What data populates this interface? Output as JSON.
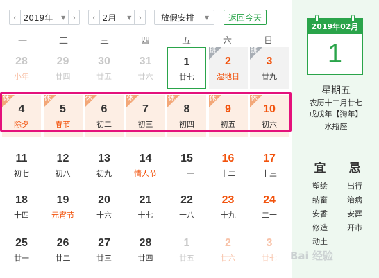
{
  "toolbar": {
    "year": "2019年",
    "month": "2月",
    "holiday": "放假安排",
    "today": "返回今天",
    "prev": "‹",
    "next": "›"
  },
  "weekdays": [
    "一",
    "二",
    "三",
    "四",
    "五",
    "六",
    "日"
  ],
  "rows": [
    [
      {
        "d": "28",
        "l": "小年",
        "other": true,
        "fest": true
      },
      {
        "d": "29",
        "l": "廿四",
        "other": true
      },
      {
        "d": "30",
        "l": "廿五",
        "other": true
      },
      {
        "d": "31",
        "l": "廿六",
        "other": true
      },
      {
        "d": "1",
        "l": "廿七",
        "today": true
      },
      {
        "d": "2",
        "l": "湿地日",
        "weekend": true,
        "fest": true,
        "tag": "班",
        "tagType": "work"
      },
      {
        "d": "3",
        "l": "廿九",
        "weekend": true,
        "tag": "班",
        "tagType": "work"
      }
    ],
    [
      {
        "d": "4",
        "l": "除夕",
        "fest": true,
        "tag": "休",
        "tagType": "rest"
      },
      {
        "d": "5",
        "l": "春节",
        "fest": true,
        "tag": "休",
        "tagType": "rest"
      },
      {
        "d": "6",
        "l": "初二",
        "tag": "休",
        "tagType": "rest"
      },
      {
        "d": "7",
        "l": "初三",
        "tag": "休",
        "tagType": "rest"
      },
      {
        "d": "8",
        "l": "初四",
        "tag": "休",
        "tagType": "rest"
      },
      {
        "d": "9",
        "l": "初五",
        "weekend": true,
        "tag": "休",
        "tagType": "rest"
      },
      {
        "d": "10",
        "l": "初六",
        "weekend": true,
        "tag": "休",
        "tagType": "rest"
      }
    ],
    [
      {
        "d": "11",
        "l": "初七"
      },
      {
        "d": "12",
        "l": "初八"
      },
      {
        "d": "13",
        "l": "初九"
      },
      {
        "d": "14",
        "l": "情人节",
        "fest": true
      },
      {
        "d": "15",
        "l": "十一"
      },
      {
        "d": "16",
        "l": "十二",
        "weekend": true
      },
      {
        "d": "17",
        "l": "十三",
        "weekend": true
      }
    ],
    [
      {
        "d": "18",
        "l": "十四"
      },
      {
        "d": "19",
        "l": "元宵节",
        "fest": true
      },
      {
        "d": "20",
        "l": "十六"
      },
      {
        "d": "21",
        "l": "十七"
      },
      {
        "d": "22",
        "l": "十八"
      },
      {
        "d": "23",
        "l": "十九",
        "weekend": true
      },
      {
        "d": "24",
        "l": "二十",
        "weekend": true
      }
    ],
    [
      {
        "d": "25",
        "l": "廿一"
      },
      {
        "d": "26",
        "l": "廿二"
      },
      {
        "d": "27",
        "l": "廿三"
      },
      {
        "d": "28",
        "l": "廿四"
      },
      {
        "d": "1",
        "l": "廿五",
        "other": true
      },
      {
        "d": "2",
        "l": "廿六",
        "other": true,
        "weekend": true
      },
      {
        "d": "3",
        "l": "廿七",
        "other": true,
        "weekend": true
      }
    ]
  ],
  "side": {
    "card_header": "2019年02月",
    "day": "1",
    "weekday": "星期五",
    "lunar": "农历十二月廿七",
    "ganzhi": "戊戌年【狗年】",
    "zodiac": "水瓶座",
    "yi_title": "宜",
    "ji_title": "忌",
    "yi": [
      "塑绘",
      "纳畜",
      "安香",
      "修造",
      "动土"
    ],
    "ji": [
      "出行",
      "治病",
      "安葬",
      "开市"
    ]
  },
  "watermark": "Bai 经验",
  "colors": {
    "accent": "#2aa44a",
    "holiday": "#f2530d",
    "highlight": "#e4117b"
  }
}
